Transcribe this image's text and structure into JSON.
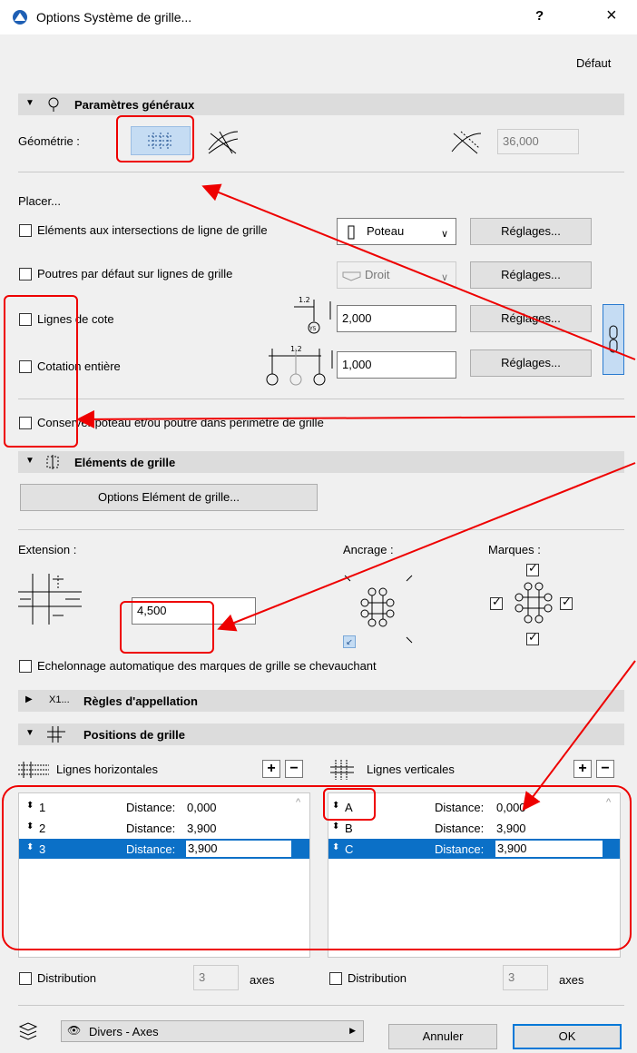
{
  "window": {
    "title": "Options Système de grille...",
    "help": "?",
    "close": "×"
  },
  "defaut": "Défaut",
  "general": {
    "section": "Paramètres généraux",
    "geometry_label": "Géométrie :",
    "angle_value": "36,000",
    "placer": "Placer...",
    "elements_intersections": "Eléments aux intersections de ligne de grille",
    "poteau": "Poteau",
    "poutres": "Poutres par défaut sur lignes de grille",
    "droit": "Droit",
    "reglages": "Réglages...",
    "lignes_cote": "Lignes de cote",
    "lignes_cote_value": "2,000",
    "cotation_entiere": "Cotation entière",
    "cotation_value": "1,000",
    "conserver": "Conserver poteau et/ou poutre dans périmètre de grille",
    "dim_label_1": "1.2",
    "dim_label_2": "1.2",
    "marker_y5": "Y5"
  },
  "elements": {
    "section": "Eléments de grille",
    "options_btn": "Options Elément de grille...",
    "extension_label": "Extension :",
    "extension_value": "4,500",
    "ancrage_label": "Ancrage :",
    "marques_label": "Marques :",
    "echelonnage": "Echelonnage automatique des marques de grille se chevauchant"
  },
  "naming": {
    "section": "Règles d'appellation",
    "prefix": "X1..."
  },
  "positions": {
    "section": "Positions de grille",
    "horizontal_title": "Lignes horizontales",
    "vertical_title": "Lignes verticales",
    "horizontal": [
      {
        "name": "1",
        "label": "Distance:",
        "value": "0,000"
      },
      {
        "name": "2",
        "label": "Distance:",
        "value": "3,900"
      },
      {
        "name": "3",
        "label": "Distance:",
        "value": "3,900"
      }
    ],
    "vertical": [
      {
        "name": "A",
        "label": "Distance:",
        "value": "0,000"
      },
      {
        "name": "B",
        "label": "Distance:",
        "value": "3,900"
      },
      {
        "name": "C",
        "label": "Distance:",
        "value": "3,900"
      }
    ],
    "distribution": "Distribution",
    "dist_h_value": "3",
    "dist_v_value": "3",
    "axes": "axes"
  },
  "footer": {
    "layer": "Divers - Axes",
    "cancel": "Annuler",
    "ok": "OK"
  }
}
